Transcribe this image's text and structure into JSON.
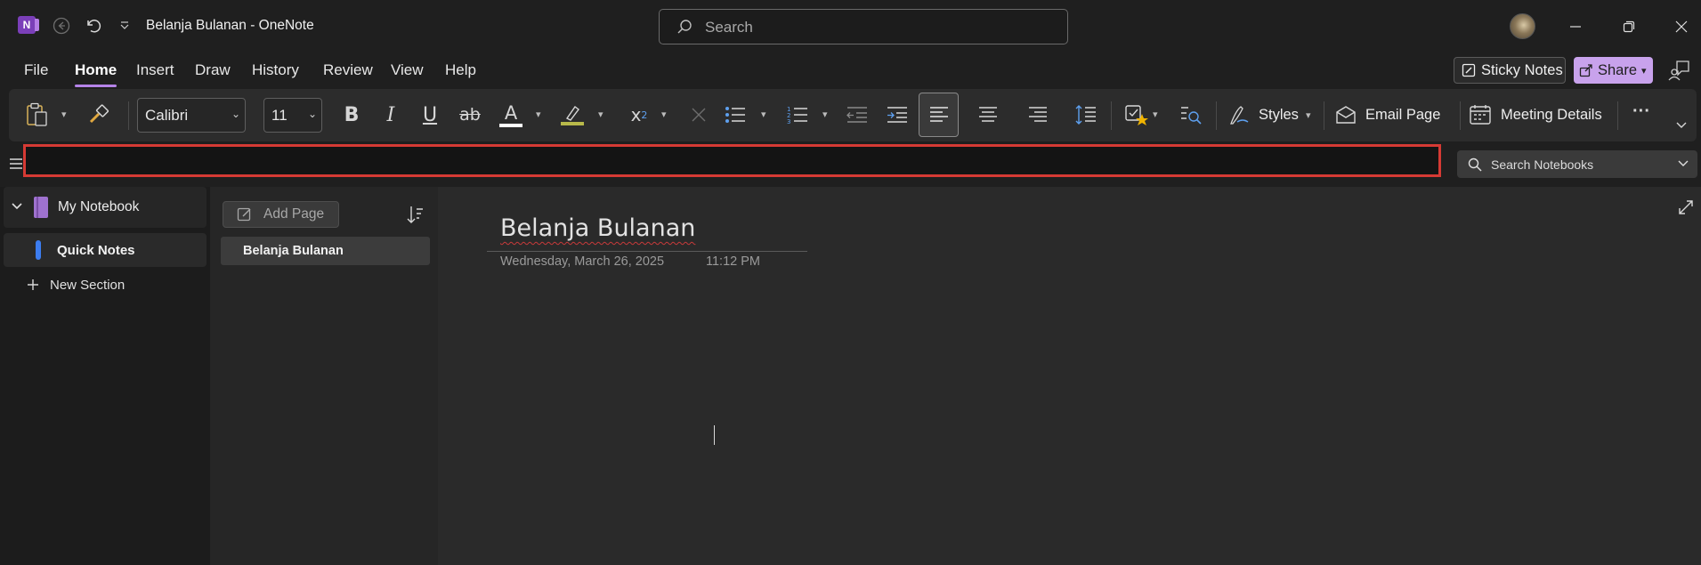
{
  "window": {
    "title": "Belanja Bulanan  -  OneNote",
    "app_logo_letter": "N",
    "search_placeholder": "Search"
  },
  "menu": {
    "tabs": [
      {
        "label": "File",
        "active": false
      },
      {
        "label": "Home",
        "active": true
      },
      {
        "label": "Insert",
        "active": false
      },
      {
        "label": "Draw",
        "active": false
      },
      {
        "label": "History",
        "active": false
      },
      {
        "label": "Review",
        "active": false
      },
      {
        "label": "View",
        "active": false
      },
      {
        "label": "Help",
        "active": false
      }
    ],
    "sticky_notes_label": "Sticky Notes",
    "share_label": "Share"
  },
  "ribbon": {
    "font_name": "Calibri",
    "font_size": "11",
    "styles_label": "Styles",
    "email_page_label": "Email Page",
    "meeting_details_label": "Meeting Details",
    "more_label": "···"
  },
  "breadcrumb": {
    "text": "",
    "search_notebooks_label": "Search Notebooks"
  },
  "notebook_pane": {
    "notebook_name": "My Notebook",
    "sections": [
      {
        "label": "Quick Notes",
        "selected": true,
        "color": "#3c7df0"
      }
    ],
    "new_section_label": "New Section"
  },
  "page_pane": {
    "add_page_label": "Add Page",
    "pages": [
      {
        "label": "Belanja Bulanan",
        "selected": true
      }
    ]
  },
  "note": {
    "title": "Belanja Bulanan",
    "date": "Wednesday, March 26, 2025",
    "time": "11:12 PM"
  },
  "colors": {
    "accent": "#b583e8",
    "share_bg": "#c8a2ec",
    "highlight_box": "#d63a34",
    "section_quick_notes": "#3c7df0",
    "background": "#1f1f1f"
  }
}
